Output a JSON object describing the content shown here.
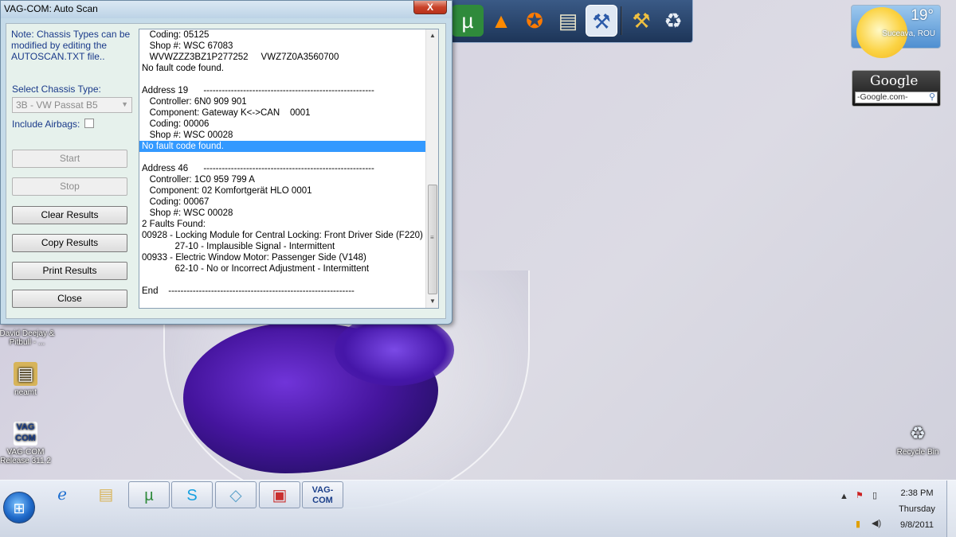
{
  "window": {
    "title": "VAG-COM: Auto Scan",
    "close_glyph": "X"
  },
  "sidebar": {
    "note": "Note:  Chassis Types can be modified by editing the AUTOSCAN.TXT file..",
    "chassis_label": "Select Chassis Type:",
    "chassis_value": "3B - VW Passat B5",
    "airbag_label": "Include Airbags:",
    "airbag_checked": false,
    "buttons": {
      "start": "Start",
      "stop": "Stop",
      "clear": "Clear Results",
      "copy": "Copy Results",
      "print": "Print Results",
      "close": "Close"
    }
  },
  "results": {
    "lines": [
      "   Coding: 05125",
      "   Shop #: WSC 67083",
      "   WVWZZZ3BZ1P277252     VWZ7Z0A3560700",
      "No fault code found.",
      "",
      "Address 19      --------------------------------------------------------",
      "   Controller: 6N0 909 901",
      "   Component: Gateway K<->CAN    0001",
      "   Coding: 00006",
      "   Shop #: WSC 00028",
      "No fault code found.",
      "",
      "Address 46      --------------------------------------------------------",
      "   Controller: 1C0 959 799 A",
      "   Component: 02 Komfortgerät HLO 0001",
      "   Coding: 00067",
      "   Shop #: WSC 00028",
      "2 Faults Found:",
      "00928 - Locking Module for Central Locking: Front Driver Side (F220)",
      "             27-10 - Implausible Signal - Intermittent",
      "00933 - Electric Window Motor: Passenger Side (V148)",
      "             62-10 - No or Incorrect Adjustment - Intermittent",
      "",
      "End    -------------------------------------------------------------"
    ],
    "selected_line": 10
  },
  "gadgets": {
    "weather": {
      "temp": "19°",
      "city": "Suceava, ROU"
    },
    "google": {
      "logo": "Google",
      "placeholder": "-Google.com-"
    }
  },
  "desktop_icons": [
    {
      "label": "David Deejay & Pitbull - ..."
    },
    {
      "label": "neamt"
    },
    {
      "label": "VAG-COM Release 311.2"
    },
    {
      "label": "Recycle Bin"
    }
  ],
  "taskbar": {
    "time": "2:38 PM",
    "day": "Thursday",
    "date": "9/8/2011",
    "vag_label": "VAG-COM"
  },
  "colors": {
    "selection": "#3399ff",
    "label_blue": "#1a3a8a",
    "window_frame": "#c5dbe9"
  }
}
